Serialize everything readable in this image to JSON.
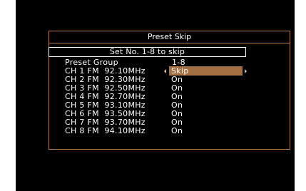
{
  "menu": {
    "title": "Preset Skip",
    "instruction": "Set No. 1-8 to skip",
    "group_label": "Preset Group",
    "group_value": "1-8"
  },
  "channels": [
    {
      "label": "CH 1 FM  92.10MHz",
      "value": "Skip",
      "selected": true
    },
    {
      "label": "CH 2 FM  92.30MHz",
      "value": "On"
    },
    {
      "label": "CH 3 FM  92.50MHz",
      "value": "On"
    },
    {
      "label": "CH 4 FM  92.70MHz",
      "value": "On"
    },
    {
      "label": "CH 5 FM  93.10MHz",
      "value": "On"
    },
    {
      "label": "CH 6 FM  93.50MHz",
      "value": "On"
    },
    {
      "label": "CH 7 FM  93.70MHz",
      "value": "On"
    },
    {
      "label": "CH 8 FM  94.10MHz",
      "value": "On"
    }
  ],
  "colors": {
    "frame": "#b47a48",
    "highlight": "#a46f42",
    "background": "#000000",
    "text": "#ffffff"
  }
}
